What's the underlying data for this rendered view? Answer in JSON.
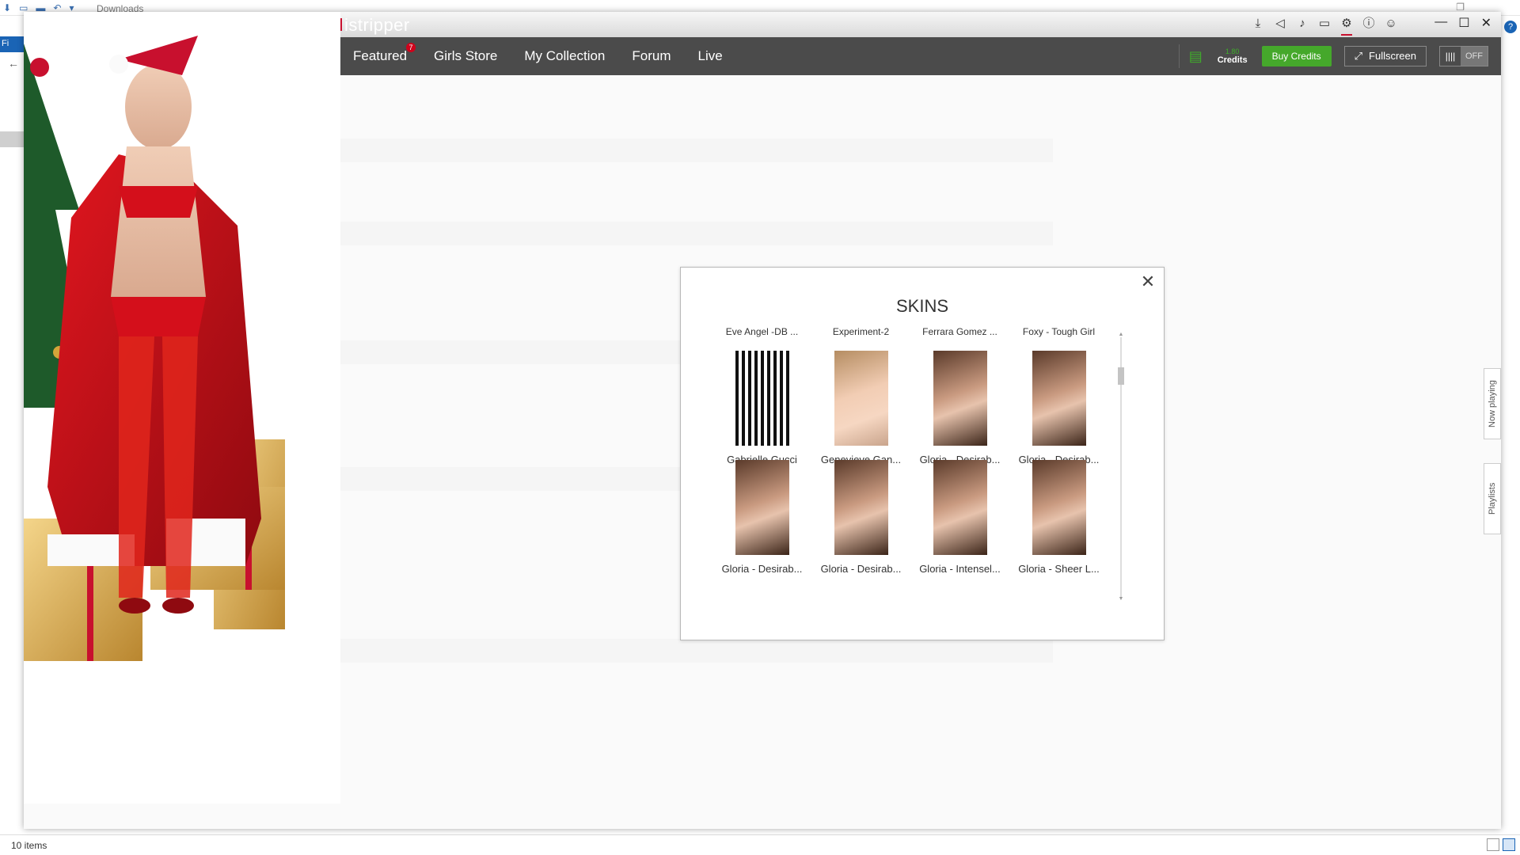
{
  "explorer": {
    "path": "Downloads",
    "file_tab": "Fi",
    "status_count": "10 items"
  },
  "app": {
    "brand": "istripper",
    "nav": [
      {
        "label": "Featured",
        "badge": "7"
      },
      {
        "label": "Girls Store"
      },
      {
        "label": "My Collection"
      },
      {
        "label": "Forum"
      },
      {
        "label": "Live"
      }
    ],
    "credits_value": "1.80",
    "credits_label": "Credits",
    "buy_label": "Buy Credits",
    "fullscreen_label": "Fullscreen",
    "toggle_label": "OFF",
    "accent": "#c8102e",
    "green": "#45a82b",
    "side_tabs": [
      "Now playing",
      "Playlists"
    ]
  },
  "dialog": {
    "title": "SKINS",
    "top_labels": [
      "Eve Angel -DB ...",
      "Experiment-2",
      "Ferrara Gomez ...",
      "Foxy - Tough Girl"
    ],
    "rows": [
      [
        {
          "name": "Gabrielle Gucci",
          "style": "stripes"
        },
        {
          "name": "Genevieve Gan...",
          "style": "bright"
        },
        {
          "name": "Gloria - Desirab...",
          "style": "dark"
        },
        {
          "name": "Gloria - Desirab...",
          "style": "dark"
        }
      ],
      [
        {
          "name": "Gloria - Desirab...",
          "style": "dark"
        },
        {
          "name": "Gloria - Desirab...",
          "style": "dark"
        },
        {
          "name": "Gloria - Intensel...",
          "style": "dark"
        },
        {
          "name": "Gloria - Sheer L...",
          "style": "dark"
        }
      ]
    ]
  }
}
